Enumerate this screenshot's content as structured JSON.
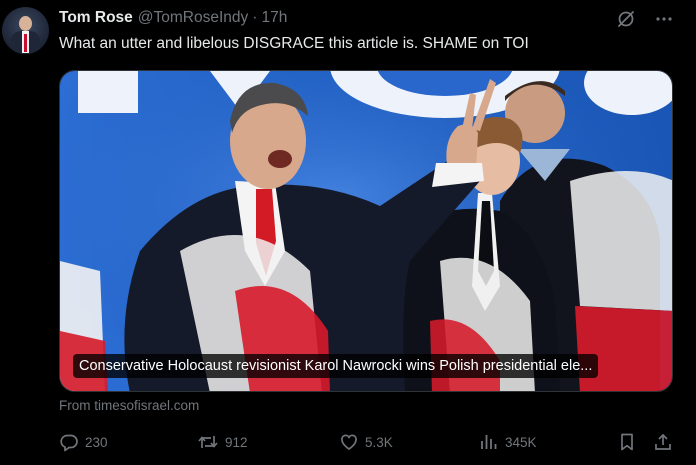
{
  "tweet": {
    "author_name": "Tom Rose",
    "handle": "@TomRoseIndy",
    "separator": "·",
    "time": "17h",
    "text": "What an utter and libelous DISGRACE this article is. SHAME on TOI",
    "card": {
      "caption": "Conservative Holocaust revisionist Karol Nawrocki wins Polish presidential ele...",
      "source": "From timesofisrael.com"
    },
    "stats": {
      "replies": "230",
      "reposts": "912",
      "likes": "5.3K",
      "views": "345K"
    }
  },
  "icons": {
    "grok": "grok-icon",
    "more": "more-icon",
    "reply": "reply-icon",
    "repost": "repost-icon",
    "like": "like-icon",
    "views": "views-icon",
    "bookmark": "bookmark-icon",
    "share": "share-icon"
  },
  "colors": {
    "background": "#000000",
    "text_primary": "#e7e9ea",
    "text_secondary": "#71767b",
    "stage_blue": "#1e63c7",
    "flag_red": "#d61a2a"
  }
}
